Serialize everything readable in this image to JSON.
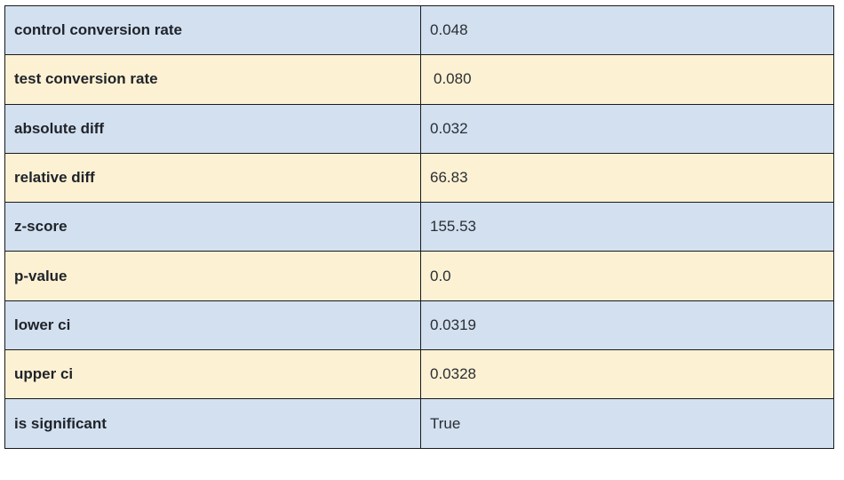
{
  "colors": {
    "row_blue": "#d2e0f0",
    "row_yellow": "#fdf1d3",
    "border": "#1a1a1a"
  },
  "rows": [
    {
      "label": "control conversion rate",
      "value": "0.048",
      "tone": "blue"
    },
    {
      "label": "test conversion rate",
      "value": "0.080",
      "tone": "yellow"
    },
    {
      "label": "absolute diff",
      "value": "0.032",
      "tone": "blue"
    },
    {
      "label": "relative diff",
      "value": "66.83",
      "tone": "yellow"
    },
    {
      "label": "z-score",
      "value": "155.53",
      "tone": "blue"
    },
    {
      "label": "p-value",
      "value": "0.0",
      "tone": "yellow"
    },
    {
      "label": "lower ci",
      "value": "0.0319",
      "tone": "blue"
    },
    {
      "label": "upper ci",
      "value": "0.0328",
      "tone": "yellow"
    },
    {
      "label": "is significant",
      "value": "True",
      "tone": "blue"
    }
  ]
}
